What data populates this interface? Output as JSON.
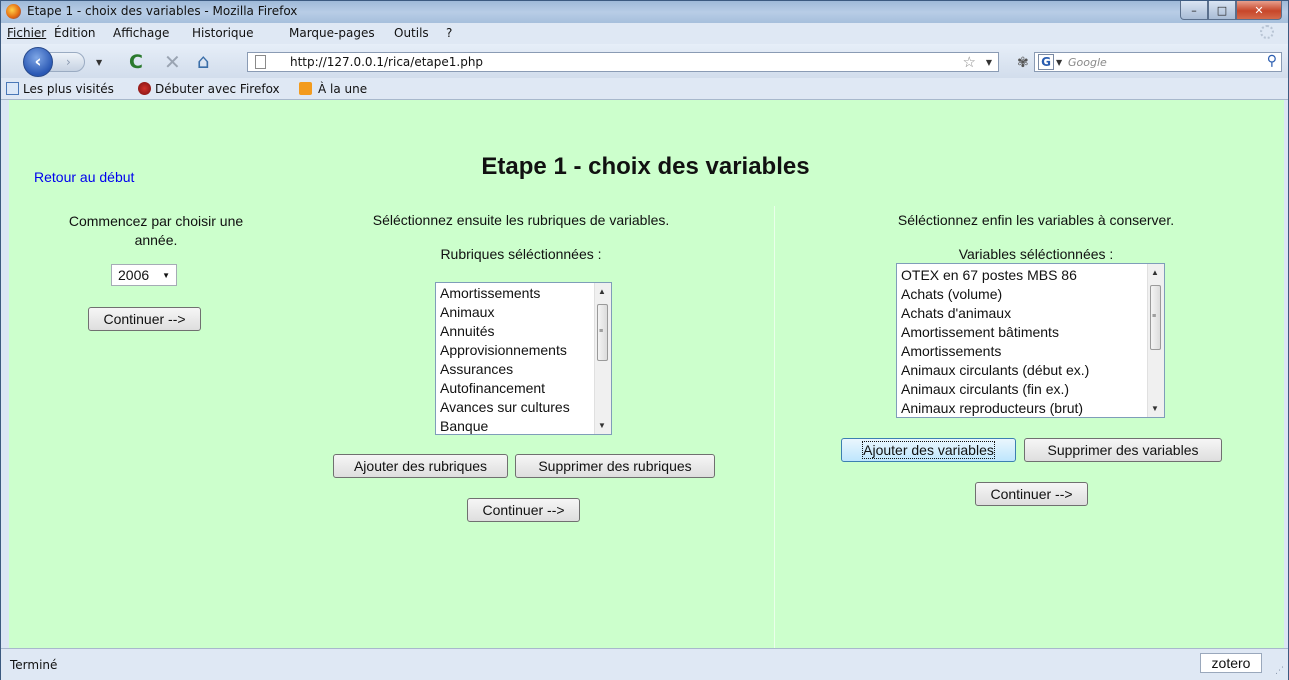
{
  "window": {
    "title": "Etape 1 - choix des variables - Mozilla Firefox",
    "min": "–",
    "max": "□",
    "close": "✕"
  },
  "menu": [
    "Fichier",
    "Édition",
    "Affichage",
    "Historique",
    "Marque-pages",
    "Outils",
    "?"
  ],
  "nav": {
    "url": "http://127.0.0.1/rica/etape1.php",
    "search_placeholder": "Google"
  },
  "bookmarks": [
    "Les plus visités",
    "Débuter avec Firefox",
    "À la une"
  ],
  "page": {
    "retour_link": "Retour au début",
    "title": "Etape 1 - choix des variables",
    "col1": {
      "instruction": "Commencez par choisir une année.",
      "year": "2006",
      "continue": "Continuer -->"
    },
    "col2": {
      "instruction": "Séléctionnez ensuite les rubriques de variables.",
      "list_label": "Rubriques séléctionnées :",
      "items": [
        "Amortissements",
        "Animaux",
        "Annuités",
        "Approvisionnements",
        "Assurances",
        "Autofinancement",
        "Avances sur cultures",
        "Banque"
      ],
      "add": "Ajouter des rubriques",
      "remove": "Supprimer des rubriques",
      "continue": "Continuer -->"
    },
    "col3": {
      "instruction": "Séléctionnez enfin les variables à conserver.",
      "list_label": "Variables séléctionnées :",
      "items": [
        "OTEX en 67 postes MBS 86",
        "Achats (volume)",
        "Achats d'animaux",
        "Amortissement bâtiments",
        "Amortissements",
        "Animaux circulants (début ex.)",
        "Animaux circulants (fin ex.)",
        "Animaux reproducteurs (brut)"
      ],
      "add": "Ajouter des variables",
      "remove": "Supprimer des variables",
      "continue": "Continuer -->"
    }
  },
  "status": {
    "text": "Terminé",
    "zotero": "zotero"
  }
}
